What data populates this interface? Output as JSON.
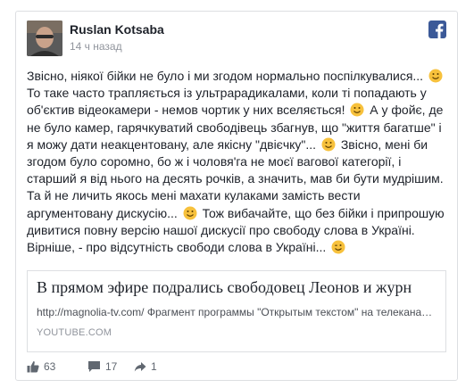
{
  "post": {
    "author": "Ruslan Kotsaba",
    "time": "14 ч назад",
    "paragraph_parts": [
      "Звісно, ніякої бійки не було і ми згодом нормально поспілкувалися... ",
      " То таке часто трапляється із ультрарадикалами, коли ті попадають у об'єктив відеокамери - немов чортик у них вселяється! ",
      " А у фойє, де не було камер, гарячкуватий свободівець збагнув, що \"життя багатше\" і я можу дати неакцентовану, але якісну \"двієчку\"... ",
      " Звісно, мені би згодом було соромно, бо ж і чоловя'га не моєї вагової категорії, і старший я від нього на десять рочків, а значить, мав би бути мудрішим. Та й не личить якось мені махати кулаками замість вести аргументовану дискусію... ",
      " Тож вибачайте, що без бійки і припрошую дивитися повну версію нашої дискусії про свободу слова в Україні. Вірніше, - про відсутність свободи слова в Україні... "
    ],
    "emoji_icons": [
      "smile-emoji-icon",
      "wink-emoji-icon"
    ]
  },
  "link_preview": {
    "title": "В прямом эфире подрались свободовец Леонов и журн",
    "description": "http://magnolia-tv.com/ Фрагмент программы \"Открытым текстом\" на телекана…",
    "domain": "YOUTUBE.COM"
  },
  "footer": {
    "likes": "63",
    "comments": "17",
    "shares": "1"
  },
  "colors": {
    "brand": "#3b5998",
    "text": "#1d2129",
    "meta": "#90949c",
    "emoji": "#f7c13c"
  }
}
